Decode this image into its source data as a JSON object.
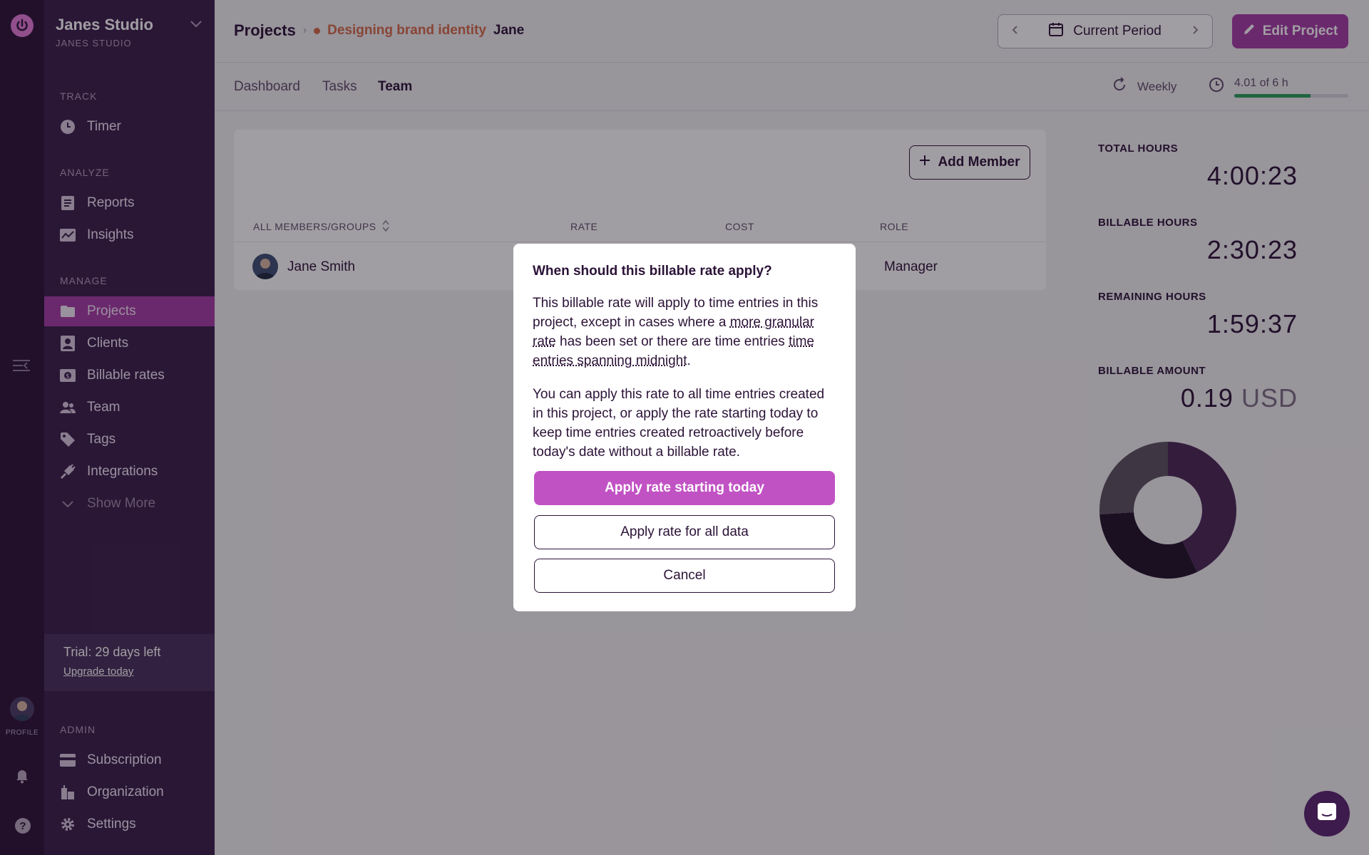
{
  "workspace": {
    "name": "Janes Studio",
    "subtitle": "JANES STUDIO"
  },
  "sidebar": {
    "sections": {
      "track": "TRACK",
      "analyze": "ANALYZE",
      "manage": "MANAGE",
      "admin": "ADMIN"
    },
    "items": [
      {
        "label": "Timer",
        "icon": "clock-icon"
      },
      {
        "label": "Reports",
        "icon": "reports-icon"
      },
      {
        "label": "Insights",
        "icon": "insights-icon"
      },
      {
        "label": "Projects",
        "icon": "folder-icon",
        "active": true
      },
      {
        "label": "Clients",
        "icon": "client-icon"
      },
      {
        "label": "Billable rates",
        "icon": "dollar-icon"
      },
      {
        "label": "Team",
        "icon": "team-icon"
      },
      {
        "label": "Tags",
        "icon": "tag-icon"
      },
      {
        "label": "Integrations",
        "icon": "plug-icon"
      },
      {
        "label": "Show More",
        "icon": "chevron-down-icon"
      }
    ],
    "admin_items": [
      {
        "label": "Subscription",
        "icon": "card-icon"
      },
      {
        "label": "Organization",
        "icon": "building-icon"
      },
      {
        "label": "Settings",
        "icon": "gear-icon"
      }
    ],
    "trial": {
      "text": "Trial: 29 days left",
      "link": "Upgrade today"
    }
  },
  "rail": {
    "profile_label": "PROFILE",
    "help_glyph": "?"
  },
  "header": {
    "breadcrumb_root": "Projects",
    "project_name": "Designing brand identity",
    "client_name": "Jane",
    "period_label": "Current Period",
    "edit_label": "Edit Project"
  },
  "tabs": [
    "Dashboard",
    "Tasks",
    "Team"
  ],
  "budget": {
    "recurrence": "Weekly",
    "text": "4.01 of 6 h",
    "progress": 0.668
  },
  "team_table": {
    "add_label": "Add Member",
    "columns": [
      "ALL MEMBERS/GROUPS",
      "RATE",
      "COST",
      "ROLE"
    ],
    "rows": [
      {
        "name": "Jane Smith",
        "role": "Manager"
      }
    ]
  },
  "stats": {
    "total_hours": {
      "label": "TOTAL HOURS",
      "value": "4:00:23"
    },
    "billable_hours": {
      "label": "BILLABLE HOURS",
      "value": "2:30:23"
    },
    "remaining_hours": {
      "label": "REMAINING HOURS",
      "value": "1:59:37"
    },
    "billable_amount": {
      "label": "BILLABLE AMOUNT",
      "value": "0.19",
      "unit": "USD"
    }
  },
  "donut_segments": [
    {
      "fraction": 0.43,
      "color": "#4a2756"
    },
    {
      "fraction": 0.31,
      "color": "#201128"
    },
    {
      "fraction": 0.26,
      "color": "#5b5360"
    }
  ],
  "modal": {
    "title": "When should this billable rate apply?",
    "p1_a": "This billable rate will apply to time entries in this project, except in cases where a ",
    "p1_link": "more granular rate",
    "p1_b": " has been set or there are time entries ",
    "p1_link2": "time entries spanning midnight",
    "p1_c": ".",
    "p2": "You can apply this rate to all time entries created in this project, or apply the rate starting today to keep time entries created retroactively before today's date without a billable rate.",
    "btn_primary": "Apply rate starting today",
    "btn_all": "Apply rate for all data",
    "btn_cancel": "Cancel"
  },
  "colors": {
    "accent": "#a63da6",
    "sidebar": "#3a1e4a",
    "rail": "#2c1338",
    "project": "#d56b48"
  }
}
